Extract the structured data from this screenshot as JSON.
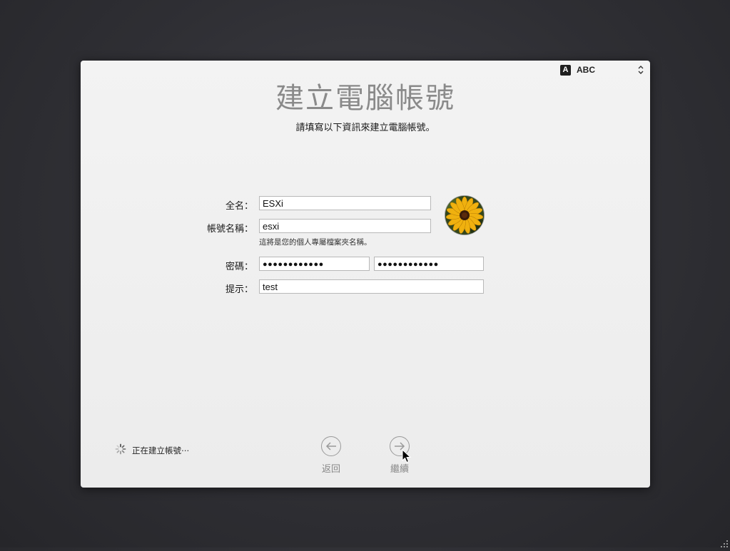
{
  "header": {
    "title": "建立電腦帳號",
    "subtitle": "請填寫以下資訊來建立電腦帳號。"
  },
  "input_menu": {
    "badge": "A",
    "name": "ABC",
    "icon": "chevron-up-down-icon"
  },
  "form": {
    "full_name": {
      "label": "全名：",
      "value": "ESXi"
    },
    "account_name": {
      "label": "帳號名稱：",
      "value": "esxi",
      "help": "這將是您的個人專屬檔案夾名稱。"
    },
    "password": {
      "label": "密碼：",
      "value": "●●●●●●●●●●●●",
      "verify_value": "●●●●●●●●●●●●"
    },
    "hint": {
      "label": "提示：",
      "value": "test"
    }
  },
  "avatar": {
    "icon": "sunflower-avatar-icon"
  },
  "status": {
    "text": "正在建立帳號⋯",
    "icon": "spinner-icon"
  },
  "nav": {
    "back_label": "返回",
    "continue_label": "繼續"
  },
  "colors": {
    "background": "#333338",
    "panel": "#eeeeee",
    "title": "#8a8a8a"
  }
}
